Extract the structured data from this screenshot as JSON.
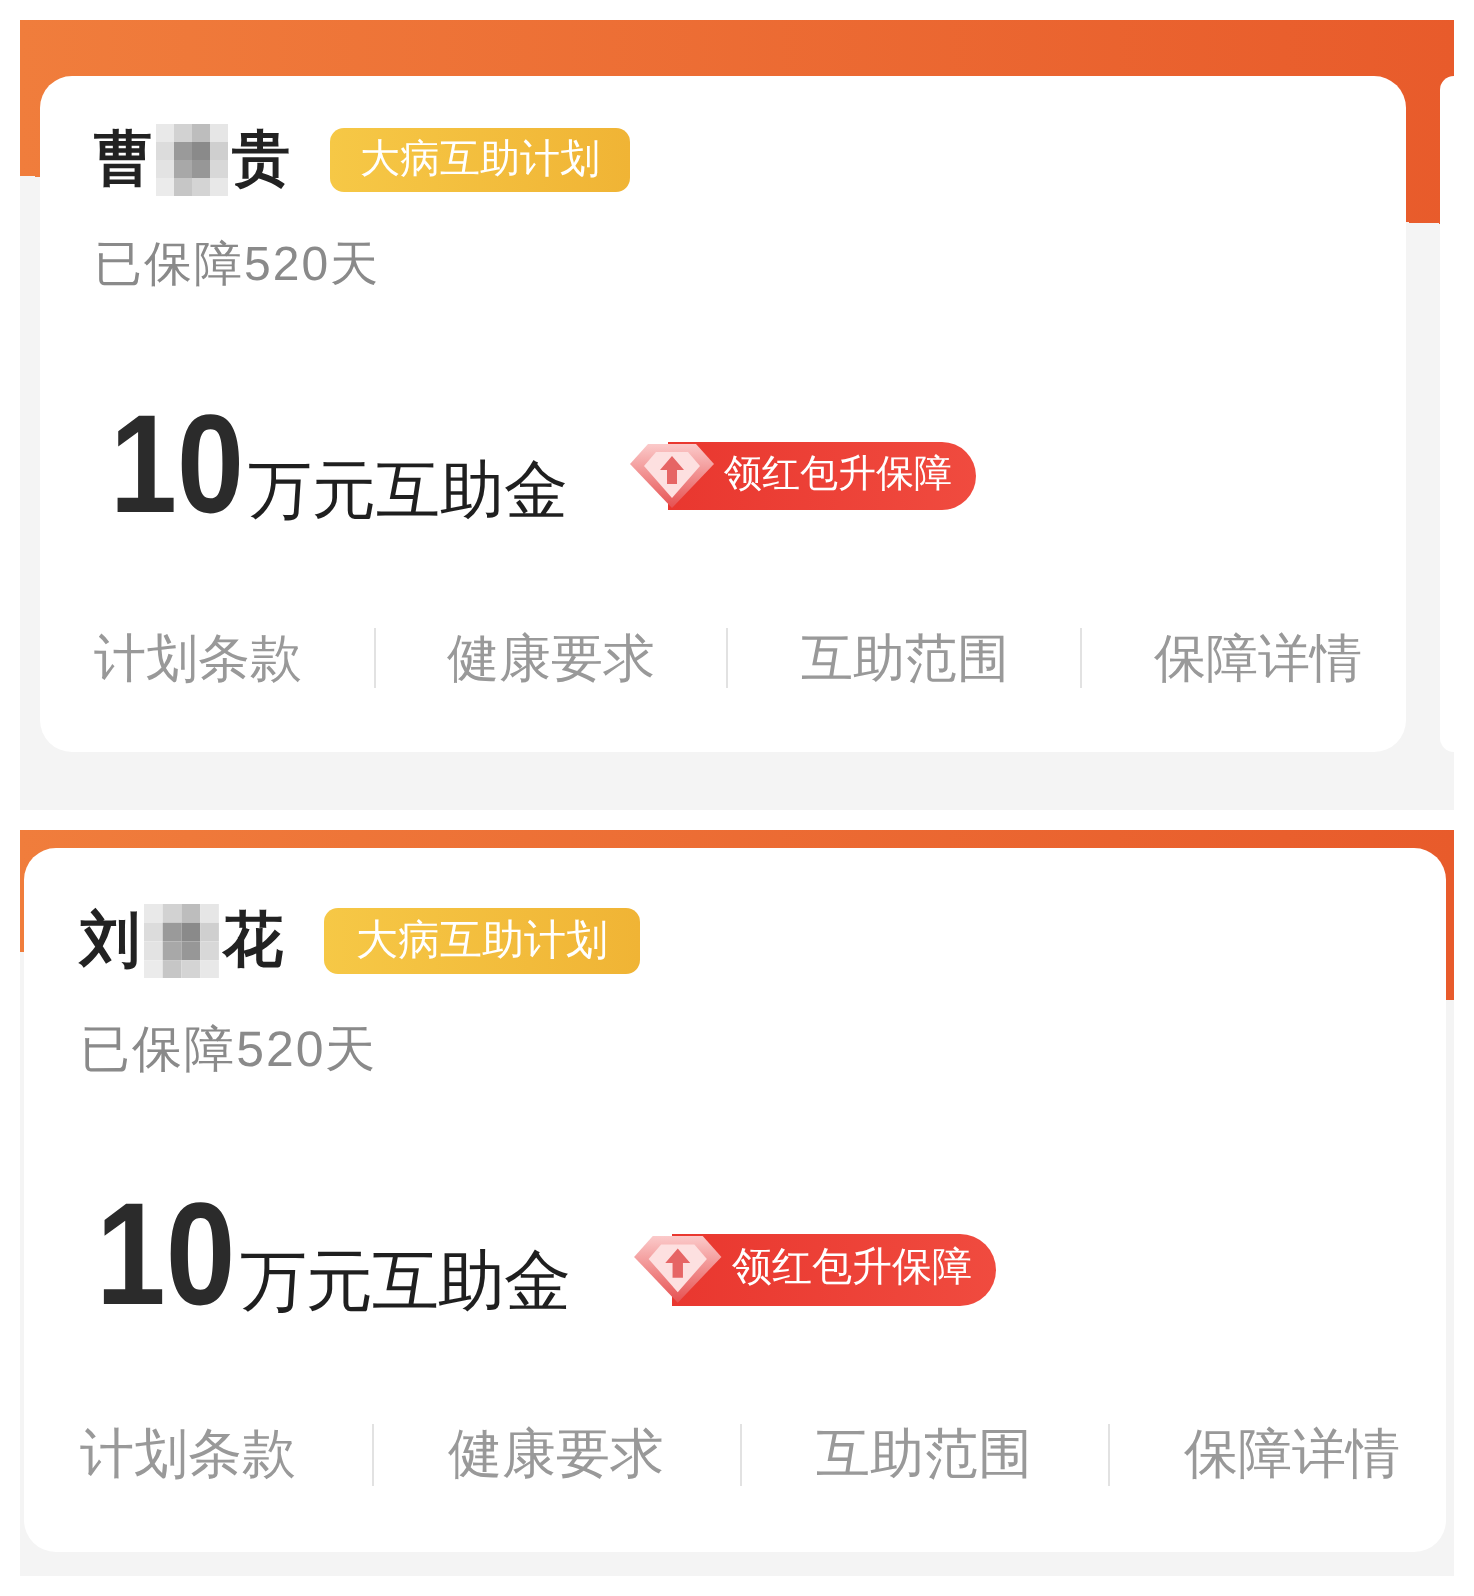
{
  "panels": [
    {
      "has_next_card": true,
      "card": {
        "name_parts": [
          "曹",
          "贵"
        ],
        "tag": "大病互助计划",
        "coverage": "已保障520天",
        "amount": "10",
        "amount_unit": "万元互助金",
        "promo_button": "领红包升保障",
        "links": [
          "计划条款",
          "健康要求",
          "互助范围",
          "保障详情"
        ]
      }
    },
    {
      "has_next_card": false,
      "card": {
        "name_parts": [
          "刘",
          "花"
        ],
        "tag": "大病互助计划",
        "coverage": "已保障520天",
        "amount": "10",
        "amount_unit": "万元互助金",
        "promo_button": "领红包升保障",
        "links": [
          "计划条款",
          "健康要求",
          "互助范围",
          "保障详情"
        ]
      }
    }
  ]
}
